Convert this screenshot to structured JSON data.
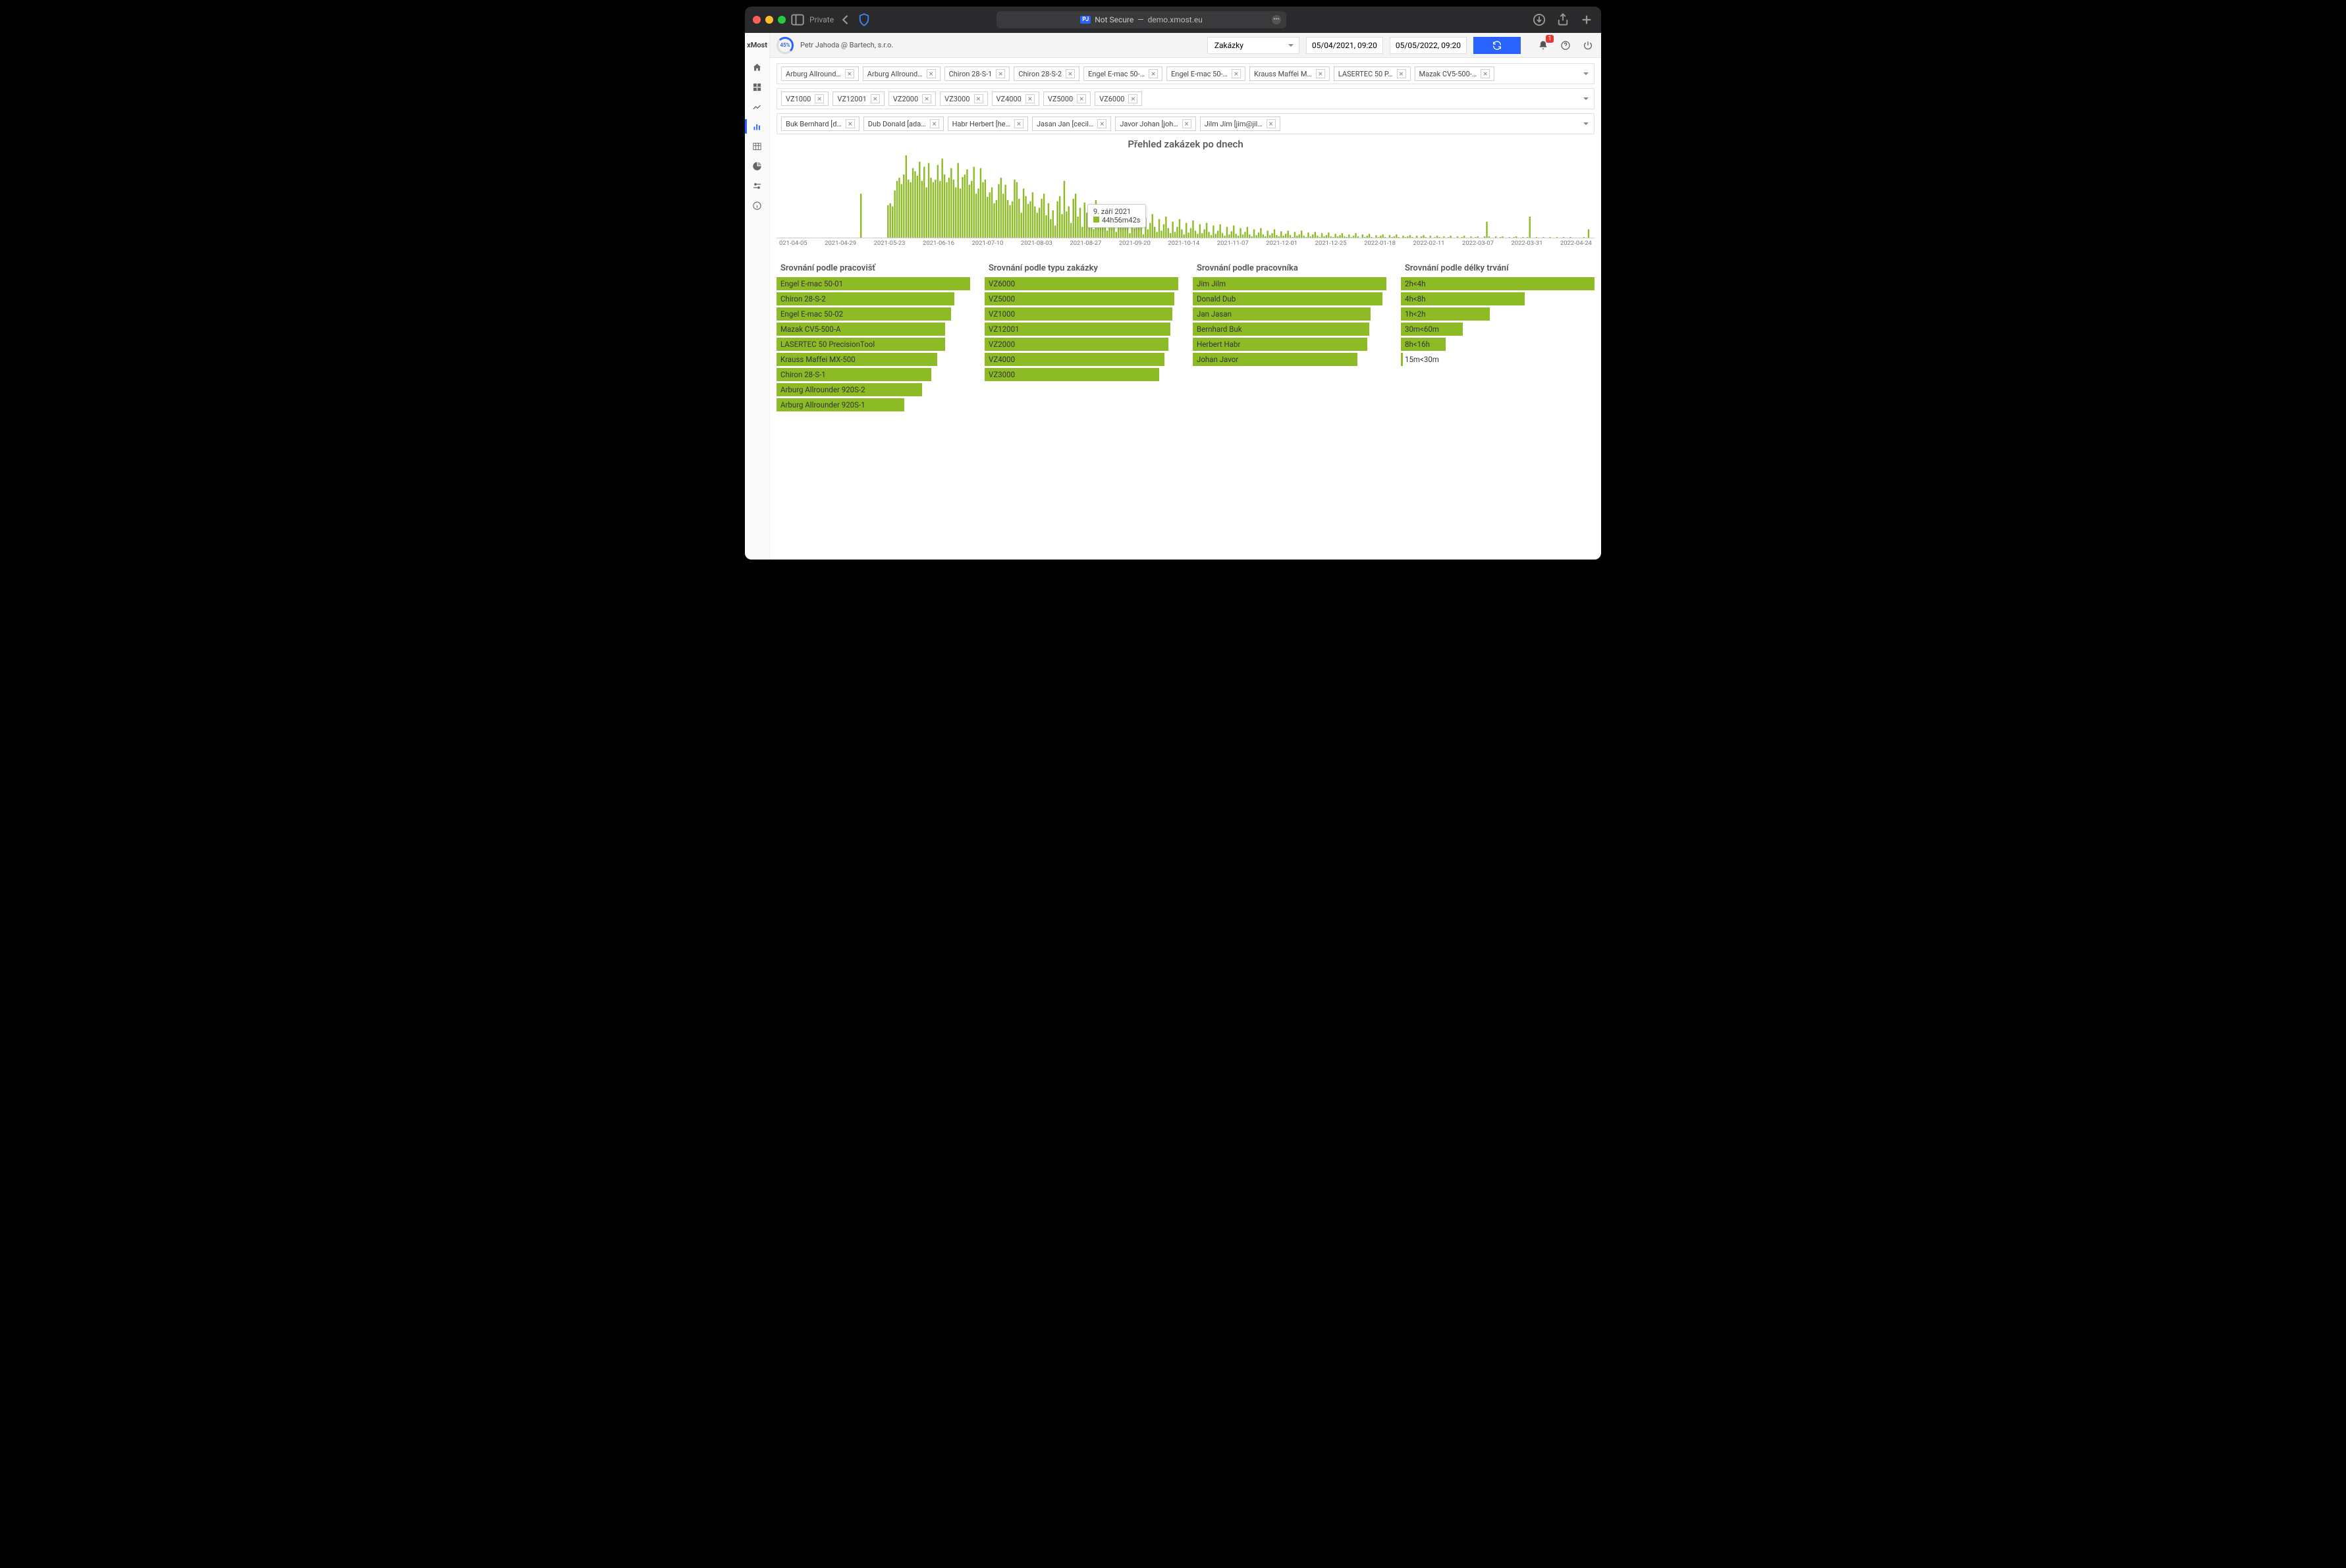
{
  "browser": {
    "private_label": "Private",
    "not_secure": "Not Secure",
    "url_host": "demo.xmost.eu"
  },
  "brand": "xMost",
  "gauge": "45%",
  "user": "Petr Jahoda @ Bartech, s.r.o.",
  "dropdown": "Zakázky",
  "date_from": "05/04/2021, 09:20",
  "date_to": "05/05/2022, 09:20",
  "badge_count": "1",
  "filters": {
    "row1": [
      "Arburg Allround…",
      "Arburg Allround…",
      "Chiron 28-S-1",
      "Chiron 28-S-2",
      "Engel E-mac 50-…",
      "Engel E-mac 50-…",
      "Krauss Maffei M…",
      "LASERTEC 50 P…",
      "Mazak CV5-500-…"
    ],
    "row2": [
      "VZ1000",
      "VZ12001",
      "VZ2000",
      "VZ3000",
      "VZ4000",
      "VZ5000",
      "VZ6000"
    ],
    "row3": [
      "Buk Bernhard [d…",
      "Dub Donald [ada…",
      "Habr Herbert [he…",
      "Jasan Jan [cecil…",
      "Javor Johan [joh…",
      "Jilm Jim [jim@jil…"
    ]
  },
  "chart_title": "Přehled zakázek po dnech",
  "tooltip": {
    "date": "9. září 2021",
    "value": "44h56m42s"
  },
  "chart_data": {
    "type": "bar",
    "title": "Přehled zakázek po dnech",
    "xlabel": "",
    "ylabel": "",
    "ylim": [
      0,
      130
    ],
    "x_ticks": [
      "021-04-05",
      "2021-04-29",
      "2021-05-23",
      "2021-06-16",
      "2021-07-10",
      "2021-08-03",
      "2021-08-27",
      "2021-09-20",
      "2021-10-14",
      "2021-11-07",
      "2021-12-01",
      "2021-12-25",
      "2022-01-18",
      "2022-02-11",
      "2022-03-07",
      "2022-03-31",
      "2022-04-24"
    ],
    "note": "daily bars; approximate values read from pixel heights",
    "values": [
      0,
      0,
      0,
      0,
      0,
      0,
      0,
      0,
      0,
      0,
      0,
      0,
      0,
      0,
      0,
      0,
      0,
      0,
      0,
      0,
      0,
      0,
      0,
      0,
      0,
      0,
      0,
      0,
      0,
      0,
      0,
      0,
      0,
      0,
      0,
      0,
      0,
      70,
      0,
      0,
      0,
      0,
      0,
      0,
      0,
      0,
      0,
      0,
      0,
      52,
      55,
      50,
      75,
      90,
      95,
      85,
      100,
      130,
      92,
      88,
      110,
      105,
      98,
      120,
      90,
      112,
      80,
      118,
      95,
      88,
      92,
      115,
      90,
      125,
      100,
      88,
      95,
      110,
      92,
      80,
      118,
      78,
      96,
      100,
      108,
      84,
      90,
      112,
      70,
      78,
      110,
      88,
      92,
      65,
      72,
      80,
      55,
      60,
      85,
      95,
      70,
      84,
      60,
      52,
      58,
      92,
      88,
      62,
      40,
      78,
      66,
      54,
      58,
      72,
      50,
      40,
      48,
      62,
      70,
      36,
      55,
      30,
      44,
      20,
      58,
      66,
      38,
      90,
      42,
      50,
      24,
      62,
      70,
      34,
      48,
      18,
      56,
      40,
      28,
      52,
      14,
      60,
      30,
      46,
      20,
      44,
      12,
      34,
      50,
      26,
      10,
      40,
      18,
      30,
      48,
      22,
      8,
      36,
      16,
      28,
      42,
      20,
      6,
      32,
      14,
      24,
      38,
      18,
      10,
      30,
      12,
      22,
      34,
      16,
      8,
      26,
      10,
      18,
      30,
      14,
      6,
      24,
      9,
      16,
      28,
      12,
      7,
      22,
      8,
      14,
      24,
      10,
      5,
      20,
      7,
      12,
      22,
      8,
      4,
      18,
      6,
      11,
      20,
      7,
      4,
      16,
      6,
      10,
      18,
      6,
      3,
      14,
      5,
      9,
      16,
      6,
      3,
      12,
      5,
      8,
      14,
      5,
      3,
      11,
      4,
      7,
      12,
      5,
      2,
      10,
      4,
      6,
      12,
      4,
      2,
      9,
      3,
      6,
      10,
      4,
      2,
      8,
      3,
      5,
      9,
      3,
      2,
      7,
      3,
      5,
      8,
      3,
      2,
      6,
      2,
      4,
      8,
      3,
      1,
      6,
      2,
      4,
      7,
      2,
      1,
      5,
      2,
      4,
      6,
      2,
      1,
      5,
      2,
      3,
      6,
      2,
      1,
      4,
      2,
      3,
      5,
      2,
      1,
      4,
      1,
      3,
      5,
      2,
      1,
      4,
      1,
      2,
      4,
      2,
      1,
      3,
      1,
      2,
      4,
      1,
      1,
      3,
      1,
      2,
      4,
      1,
      1,
      3,
      1,
      2,
      3,
      1,
      0,
      3,
      26,
      3,
      0,
      1,
      3,
      1,
      2,
      3,
      1,
      0,
      2,
      1,
      2,
      3,
      1,
      0,
      2,
      1,
      2,
      34,
      1,
      0,
      2,
      1,
      1,
      2,
      1,
      0,
      2,
      1,
      1,
      2,
      1,
      0,
      2,
      1,
      1,
      2,
      1,
      0,
      1,
      1,
      1,
      2,
      1,
      14,
      0,
      1
    ],
    "tooltip_point": {
      "x": "2021-09-09",
      "label": "9. září 2021",
      "value_text": "44h56m42s"
    }
  },
  "compare": [
    {
      "title": "Srovnání podle pracovišť",
      "bars": [
        {
          "label": "Engel E-mac 50-01",
          "pct": 100
        },
        {
          "label": "Chiron 28-S-2",
          "pct": 92
        },
        {
          "label": "Engel E-mac 50-02",
          "pct": 90
        },
        {
          "label": "Mazak CV5-500-A",
          "pct": 87
        },
        {
          "label": "LASERTEC 50 PrecisionTool",
          "pct": 87
        },
        {
          "label": "Krauss Maffei MX-500",
          "pct": 83
        },
        {
          "label": "Chiron 28-S-1",
          "pct": 80
        },
        {
          "label": "Arburg Allrounder 920S-2",
          "pct": 75
        },
        {
          "label": "Arburg Allrounder 920S-1",
          "pct": 66
        }
      ]
    },
    {
      "title": "Srovnání podle typu zakázky",
      "bars": [
        {
          "label": "VZ6000",
          "pct": 100
        },
        {
          "label": "VZ5000",
          "pct": 98
        },
        {
          "label": "VZ1000",
          "pct": 97
        },
        {
          "label": "VZ12001",
          "pct": 96
        },
        {
          "label": "VZ2000",
          "pct": 95
        },
        {
          "label": "VZ4000",
          "pct": 93
        },
        {
          "label": "VZ3000",
          "pct": 90
        }
      ]
    },
    {
      "title": "Srovnání podle pracovníka",
      "bars": [
        {
          "label": "Jim Jilm",
          "pct": 100
        },
        {
          "label": "Donald Dub",
          "pct": 98
        },
        {
          "label": "Jan Jasan",
          "pct": 92
        },
        {
          "label": "Bernhard Buk",
          "pct": 91
        },
        {
          "label": "Herbert Habr",
          "pct": 90
        },
        {
          "label": "Johan Javor",
          "pct": 85
        }
      ]
    },
    {
      "title": "Srovnání podle délky trvání",
      "bars": [
        {
          "label": "2h<4h",
          "pct": 100
        },
        {
          "label": "4h<8h",
          "pct": 64
        },
        {
          "label": "1h<2h",
          "pct": 46
        },
        {
          "label": "30m<60m",
          "pct": 32
        },
        {
          "label": "8h<16h",
          "pct": 23
        },
        {
          "label": "15m<30m",
          "pct": 1
        }
      ]
    }
  ]
}
